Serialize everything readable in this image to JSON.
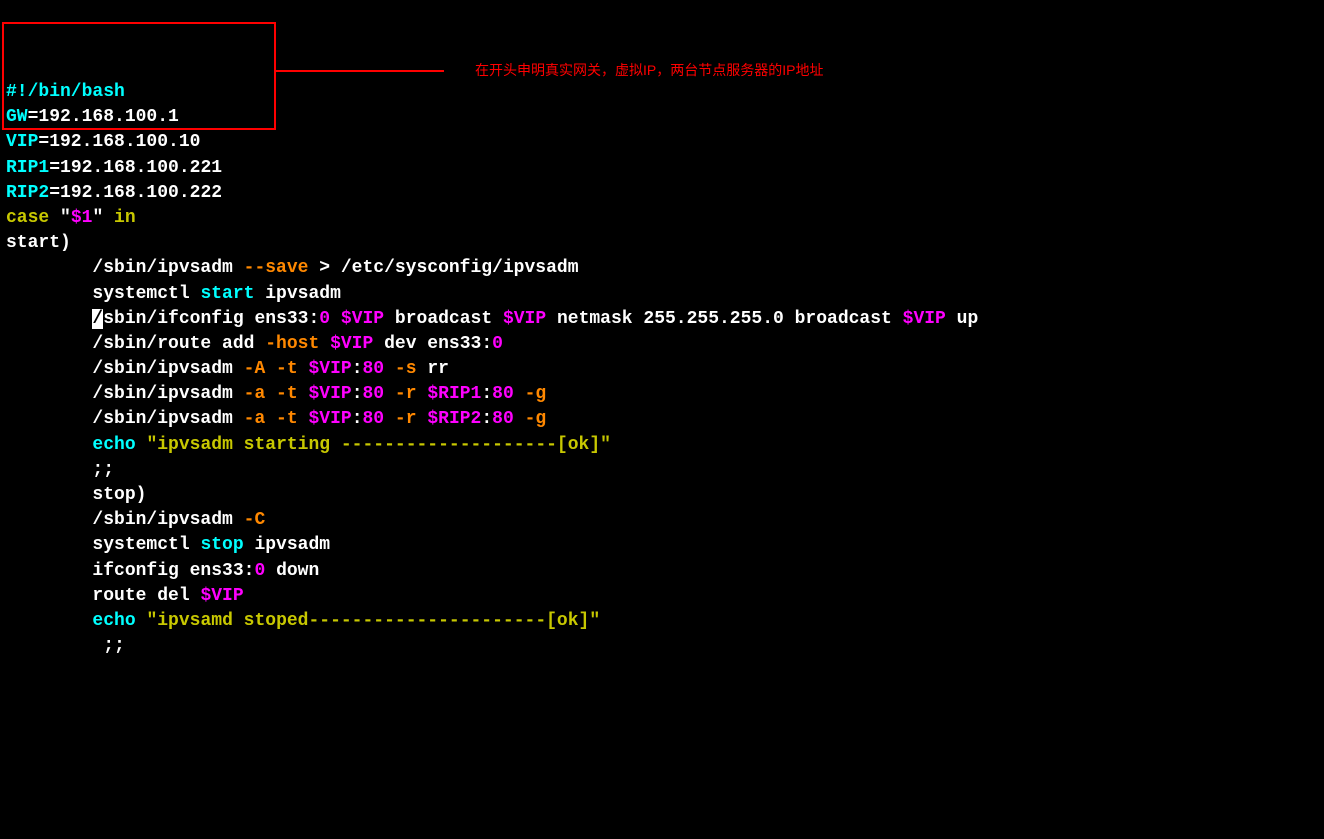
{
  "shebang": "#!/bin/bash",
  "vars": {
    "gw_name": "GW",
    "gw_val": "=192.168.100.1",
    "vip_name": "VIP",
    "vip_val": "=192.168.100.10",
    "rip1_name": "RIP1",
    "rip1_val": "=192.168.100.221",
    "rip2_name": "RIP2",
    "rip2_val": "=192.168.100.222"
  },
  "case_line": {
    "p1": "case",
    "p2": " \"",
    "p3": "$1",
    "p4": "\" ",
    "p5": "in"
  },
  "start_label": "start)",
  "l1": {
    "p1": "        /sbin/ipvsadm ",
    "p2": "--save",
    "p3": " > /etc/sysconfig/ipvsadm"
  },
  "l2": {
    "p1": "        systemctl ",
    "p2": "start",
    "p3": " ipvsadm"
  },
  "l3": {
    "p0": "        ",
    "hl": "/",
    "p1": "sbin/ifconfig ens33:",
    "p2": "0",
    "p3": " ",
    "p4": "$VIP",
    "p5": " broadcast ",
    "p6": "$VIP",
    "p7": " netmask 255.255.255.0 broadcast ",
    "p8": "$VIP",
    "p9": " up"
  },
  "l4": {
    "p1": "        /sbin/route add ",
    "p2": "-host",
    "p3": " ",
    "p4": "$VIP",
    "p5": " dev ens33:",
    "p6": "0"
  },
  "l5": {
    "p1": "        /sbin/ipvsadm ",
    "p2": "-A -t",
    "p3": " ",
    "p4": "$VIP",
    "p5": ":",
    "p6": "80",
    "p7": " ",
    "p8": "-s",
    "p9": " rr"
  },
  "l6": {
    "p1": "        /sbin/ipvsadm ",
    "p2": "-a -t",
    "p3": " ",
    "p4": "$VIP",
    "p5": ":",
    "p6": "80",
    "p7": " ",
    "p8": "-r",
    "p9": " ",
    "p10": "$RIP1",
    "p11": ":",
    "p12": "80",
    "p13": " ",
    "p14": "-g"
  },
  "l7": {
    "p1": "        /sbin/ipvsadm ",
    "p2": "-a -t",
    "p3": " ",
    "p4": "$VIP",
    "p5": ":",
    "p6": "80",
    "p7": " ",
    "p8": "-r",
    "p9": " ",
    "p10": "$RIP2",
    "p11": ":",
    "p12": "80",
    "p13": " ",
    "p14": "-g"
  },
  "l8": {
    "p1": "        ",
    "p2": "echo",
    "p3": " ",
    "p4": "\"ipvsadm starting --------------------[ok]\""
  },
  "l9": "        ;;",
  "l10": "        stop)",
  "l11": {
    "p1": "        /sbin/ipvsadm ",
    "p2": "-C"
  },
  "l12": {
    "p1": "        systemctl ",
    "p2": "stop",
    "p3": " ipvsadm"
  },
  "l13": {
    "p1": "        ifconfig ens33:",
    "p2": "0",
    "p3": " down"
  },
  "l14": {
    "p1": "        route del ",
    "p2": "$VIP"
  },
  "l15": {
    "p1": "        ",
    "p2": "echo",
    "p3": " ",
    "p4": "\"ipvsamd stoped----------------------[ok]\""
  },
  "l16": "         ;;",
  "annotation": "在开头申明真实网关，虚拟IP，两台节点服务器的IP地址"
}
